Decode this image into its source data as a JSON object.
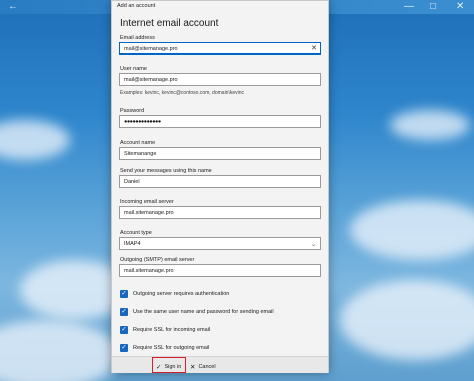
{
  "dialog": {
    "title": "Add an account",
    "heading": "Internet email account",
    "email_label": "Email address",
    "email_value": "mail@sitemanage.pro",
    "username_label": "User name",
    "username_value": "mail@sitemanage.pro",
    "username_hint": "Examples: kevinc, kevinc@contoso.com, domain\\kevinc",
    "password_label": "Password",
    "password_value": "●●●●●●●●●●●●●",
    "account_name_label": "Account name",
    "account_name_value": "Sitemanange",
    "send_name_label": "Send your messages using this name",
    "send_name_value": "Daniel",
    "incoming_label": "Incoming email server",
    "incoming_value": "mail.sitemanage.pro",
    "account_type_label": "Account type",
    "account_type_value": "IMAP4",
    "outgoing_label": "Outgoing (SMTP) email server",
    "outgoing_value": "mail.sitemanage.pro",
    "checkboxes": [
      {
        "label": "Outgoing server requires authentication",
        "checked": true
      },
      {
        "label": "Use the same user name and password for sending email",
        "checked": true
      },
      {
        "label": "Require SSL for incoming email",
        "checked": true
      },
      {
        "label": "Require SSL for outgoing email",
        "checked": true
      }
    ],
    "signin_label": "Sign in",
    "cancel_label": "Cancel"
  },
  "icons": {
    "clear": "✕",
    "chevron": "⌄",
    "check": "✓",
    "cancel": "✕"
  },
  "colors": {
    "accent": "#0067c0",
    "checkbox": "#1766c0",
    "highlight": "#d8202a"
  }
}
